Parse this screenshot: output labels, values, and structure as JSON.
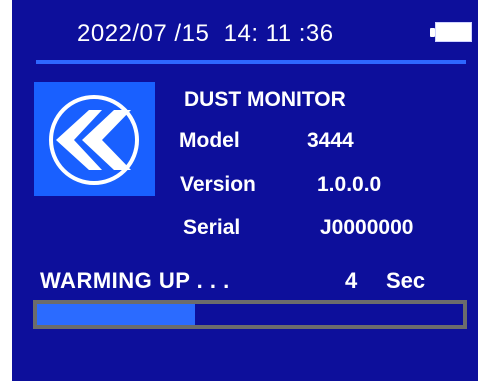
{
  "status": {
    "date": "2022/07 /15",
    "time": "14: 11 :36",
    "battery_icon": "battery-full-icon",
    "battery_level": 1.0
  },
  "logo": {
    "icon": "double-chevron-left-icon"
  },
  "device": {
    "name": "DUST MONITOR",
    "model_label": "Model",
    "model_value": "3444",
    "version_label": "Version",
    "version_value": "1.0.0.0",
    "serial_label": "Serial",
    "serial_value": "J0000000"
  },
  "warmup": {
    "label": "WARMING UP . . .",
    "count": "4",
    "unit": "Sec",
    "progress": 0.37
  },
  "colors": {
    "screen_bg": "#0d0f9b",
    "accent": "#2e67ff",
    "logo_bg": "#1960ff",
    "progress_border": "#6c6c6c",
    "text": "#ffffff"
  }
}
